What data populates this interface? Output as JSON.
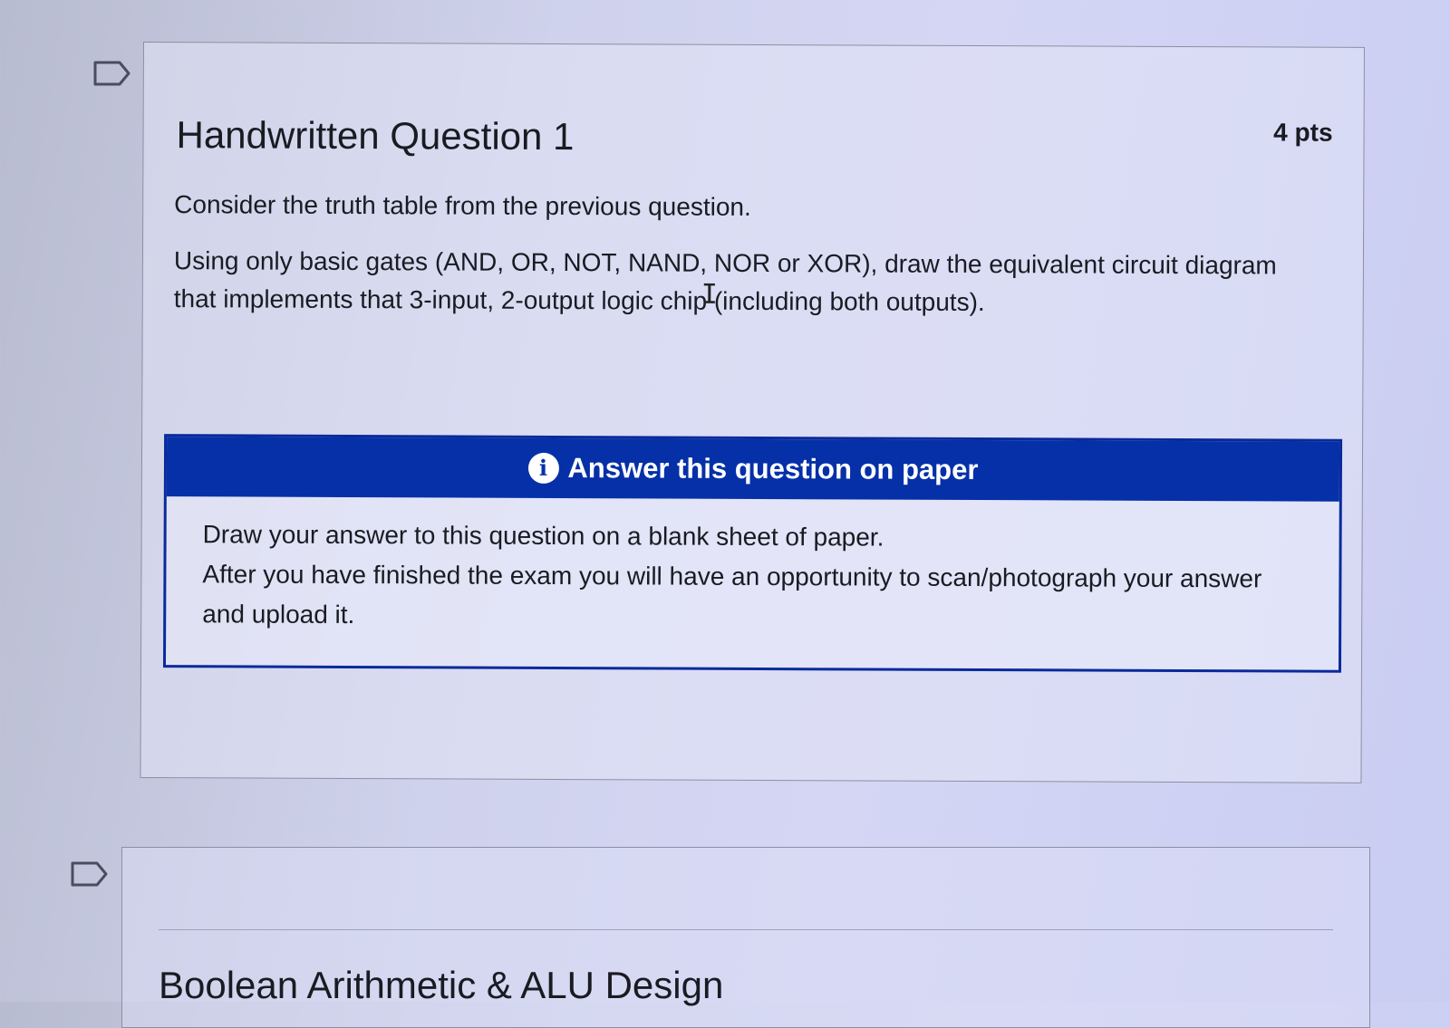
{
  "question": {
    "title": "Handwritten Question 1",
    "points": "4 pts",
    "paragraphs": [
      "Consider the truth table from the previous question.",
      "Using only basic gates (AND, OR, NOT, NAND, NOR or XOR), draw the equivalent circuit diagram that implements that 3-input, 2-output logic chip (including both outputs)."
    ]
  },
  "notice": {
    "icon": "info-icon",
    "icon_glyph": "i",
    "header": "Answer this question on paper",
    "lines": [
      "Draw your answer to this question on a blank sheet of paper.",
      "After you have finished the exam you will have an opportunity to scan/photograph your answer and upload it."
    ],
    "header_color": "#0530a8"
  },
  "next_question": {
    "title_partial": "Boolean Arithmetic & ALU Design"
  },
  "icons": {
    "flag": "flag-question-icon",
    "cursor": "text-cursor-icon"
  }
}
